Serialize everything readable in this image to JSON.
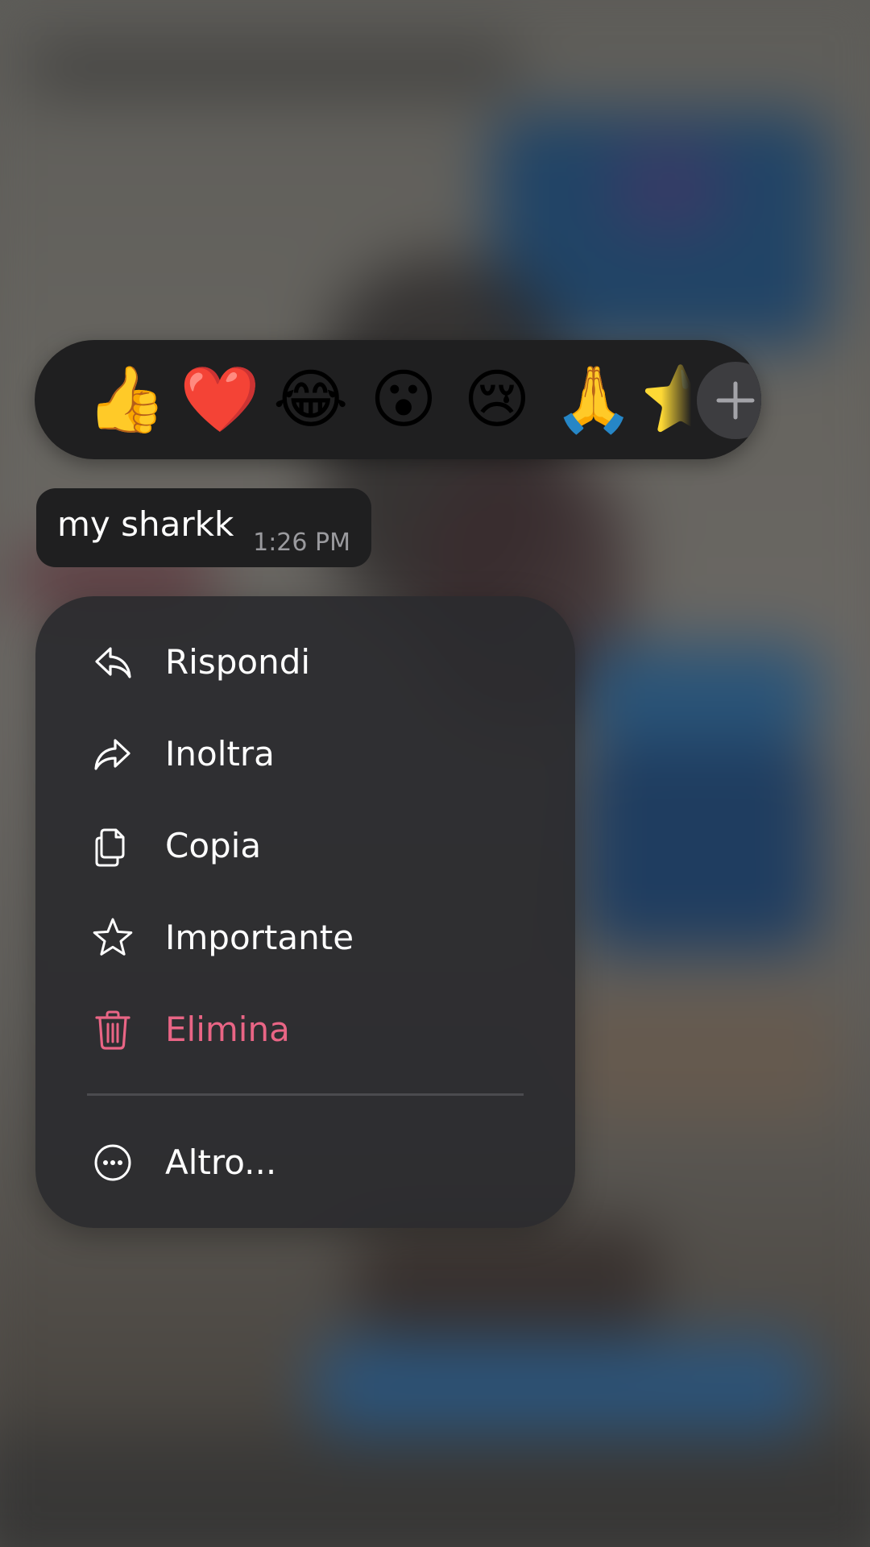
{
  "reactions": {
    "items": [
      {
        "emoji": "👍",
        "name": "thumbs-up"
      },
      {
        "emoji": "❤️",
        "name": "red-heart"
      },
      {
        "emoji": "😂",
        "name": "tears-of-joy"
      },
      {
        "emoji": "😮",
        "name": "open-mouth"
      },
      {
        "emoji": "😢",
        "name": "crying-face"
      },
      {
        "emoji": "🙏",
        "name": "folded-hands"
      },
      {
        "emoji": "⭐",
        "name": "star"
      }
    ],
    "more_icon": "plus-icon"
  },
  "message": {
    "text": "my sharkk",
    "time": "1:26 PM"
  },
  "menu": {
    "items": [
      {
        "label": "Rispondi",
        "icon": "reply-icon"
      },
      {
        "label": "Inoltra",
        "icon": "forward-icon"
      },
      {
        "label": "Copia",
        "icon": "copy-icon"
      },
      {
        "label": "Importante",
        "icon": "star-icon"
      },
      {
        "label": "Elimina",
        "icon": "trash-icon",
        "color": "#e96585"
      }
    ],
    "more": {
      "label": "Altro...",
      "icon": "more-icon"
    }
  },
  "colors": {
    "menu_background": "#2b2b2e",
    "bubble_background": "#1f1f20",
    "danger": "#e96585",
    "timestamp": "#9a9a9e"
  }
}
